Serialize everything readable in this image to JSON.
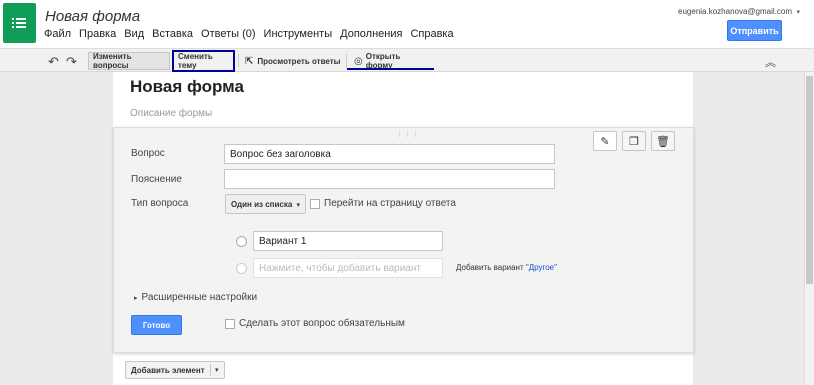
{
  "header": {
    "title": "Новая форма",
    "menu": [
      "Файл",
      "Правка",
      "Вид",
      "Вставка",
      "Ответы (0)",
      "Инструменты",
      "Дополнения",
      "Справка"
    ],
    "user_email": "eugenia.kozhanova@gmail.com",
    "send_label": "Отправить"
  },
  "toolbar": {
    "edit_questions": "Изменить вопросы",
    "change_theme": "Сменить тему",
    "view_responses": "Просмотреть ответы",
    "open_form": "Открыть форму"
  },
  "form": {
    "title": "Новая форма",
    "description_placeholder": "Описание формы"
  },
  "question": {
    "question_label": "Вопрос",
    "question_value": "Вопрос без заголовка",
    "help_label": "Пояснение",
    "help_value": "",
    "type_label": "Тип вопроса",
    "type_value": "Один из списка",
    "go_to_page_label": "Перейти на страницу ответа",
    "option1": "Вариант 1",
    "add_option_placeholder": "Нажмите, чтобы добавить вариант",
    "add_other_prefix": "Добавить вариант",
    "add_other_link": "\"Другое\"",
    "advanced_settings": "Расширенные настройки",
    "done_label": "Готово",
    "required_label": "Сделать этот вопрос обязательным"
  },
  "add_item_label": "Добавить элемент",
  "colors": {
    "accent_blue": "#4d90fe",
    "sheets_green": "#0f9d58",
    "highlight_box": "#0000a0"
  }
}
